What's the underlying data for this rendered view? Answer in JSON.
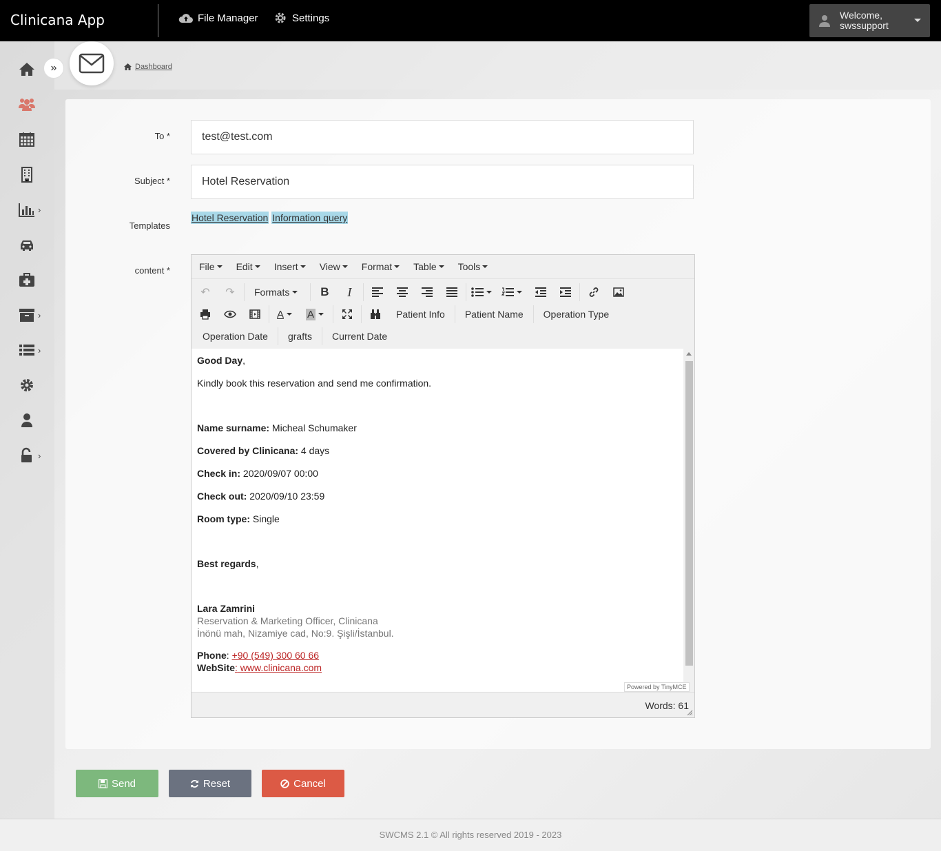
{
  "app": {
    "title": "Clinicana App"
  },
  "topnav": {
    "file_manager": "File Manager",
    "settings": "Settings"
  },
  "user": {
    "welcome": "Welcome,",
    "name": "swssupport"
  },
  "breadcrumb": {
    "dashboard": "Dashboard"
  },
  "form": {
    "to_label": "To *",
    "to_value": "test@test.com",
    "subject_label": "Subject *",
    "subject_value": "Hotel Reservation",
    "templates_label": "Templates",
    "templates": [
      "Hotel Reservation",
      "Information query"
    ],
    "content_label": "content *"
  },
  "editor": {
    "menus": [
      "File",
      "Edit",
      "Insert",
      "View",
      "Format",
      "Table",
      "Tools"
    ],
    "formats_label": "Formats",
    "custom_buttons": [
      "Patient Info",
      "Patient Name",
      "Operation Type",
      "Operation Date",
      "grafts",
      "Current Date"
    ],
    "powered_by": "Powered by TinyMCE",
    "word_count": "Words: 61"
  },
  "email": {
    "greeting_bold": "Good Day",
    "greeting_rest": ",",
    "intro": "Kindly book this reservation and send me confirmation.",
    "name_label": "Name surname:",
    "name_value": " Micheal Schumaker",
    "covered_label": "Covered by Clinicana:",
    "covered_value": " 4 days",
    "checkin_label": "Check in:",
    "checkin_value": " 2020/09/07 00:00",
    "checkout_label": "Check out:",
    "checkout_value": " 2020/09/10 23:59",
    "room_label": "Room type:",
    "room_value": " Single",
    "regards_bold": "Best regards",
    "regards_rest": ",",
    "sig_name": "Lara Zamrini",
    "sig_title": "Reservation & Marketing Officer, Clinicana",
    "sig_address": "İnönü mah, Nizamiye cad, No:9. Şişli/İstanbul.",
    "phone_label": "Phone",
    "phone_sep": ": ",
    "phone_value": "+90 (549) 300 60 66",
    "website_label": "WebSite",
    "website_sep": ":",
    "website_value": " www.clinicana.com"
  },
  "buttons": {
    "send": "Send",
    "reset": "Reset",
    "cancel": "Cancel"
  },
  "footer": {
    "text": "SWCMS 2.1 © All rights reserved 2019 - 2023"
  },
  "colors": {
    "accent_send": "#7db87d",
    "accent_reset": "#6b7280",
    "accent_cancel": "#dc5a45",
    "template_tag": "#a8d8e8",
    "link": "#b22222"
  }
}
